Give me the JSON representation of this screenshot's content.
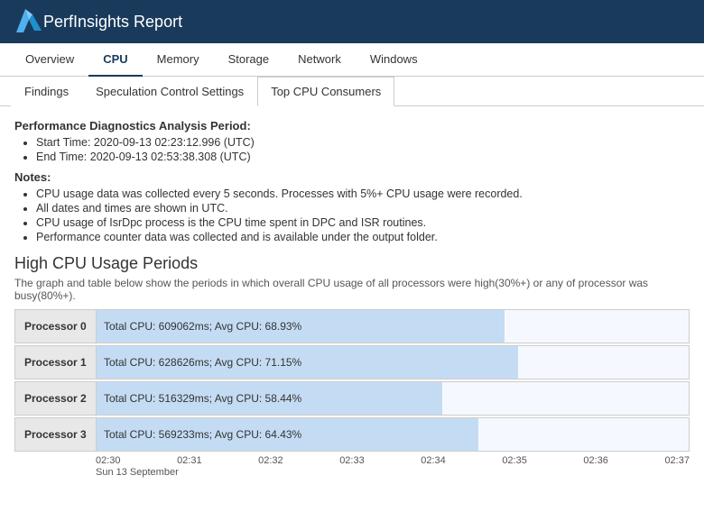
{
  "header": {
    "title": "PerfInsights Report",
    "logo_alt": "Azure logo"
  },
  "top_nav": {
    "tabs": [
      {
        "label": "Overview",
        "active": false
      },
      {
        "label": "CPU",
        "active": true
      },
      {
        "label": "Memory",
        "active": false
      },
      {
        "label": "Storage",
        "active": false
      },
      {
        "label": "Network",
        "active": false
      },
      {
        "label": "Windows",
        "active": false
      }
    ]
  },
  "sub_nav": {
    "tabs": [
      {
        "label": "Findings",
        "active": false
      },
      {
        "label": "Speculation Control Settings",
        "active": false
      },
      {
        "label": "Top CPU Consumers",
        "active": true
      }
    ]
  },
  "content": {
    "analysis_period_label": "Performance Diagnostics Analysis Period:",
    "start_time": "Start Time: 2020-09-13 02:23:12.996 (UTC)",
    "end_time": "End Time: 2020-09-13 02:53:38.308 (UTC)",
    "notes_label": "Notes:",
    "notes": [
      "CPU usage data was collected every 5 seconds. Processes with 5%+ CPU usage were recorded.",
      "All dates and times are shown in UTC.",
      "CPU usage of IsrDpc process is the CPU time spent in DPC and ISR routines.",
      "Performance counter data was collected and is available under the output folder."
    ],
    "high_cpu_title": "High CPU Usage Periods",
    "high_cpu_desc": "The graph and table below show the periods in which overall CPU usage of all processors were high(30%+) or any of processor was busy(80%+).",
    "processors": [
      {
        "label": "Processor 0",
        "info": "Total CPU: 609062ms; Avg CPU: 68.93%",
        "pct": 68.93
      },
      {
        "label": "Processor 1",
        "info": "Total CPU: 628626ms; Avg CPU: 71.15%",
        "pct": 71.15
      },
      {
        "label": "Processor 2",
        "info": "Total CPU: 516329ms; Avg CPU: 58.44%",
        "pct": 58.44
      },
      {
        "label": "Processor 3",
        "info": "Total CPU: 569233ms; Avg CPU: 64.43%",
        "pct": 64.43
      }
    ],
    "x_axis_labels": [
      "02:30",
      "02:31",
      "02:32",
      "02:33",
      "02:34",
      "02:35",
      "02:36",
      "02:37"
    ],
    "x_axis_date": "Sun 13 September"
  }
}
